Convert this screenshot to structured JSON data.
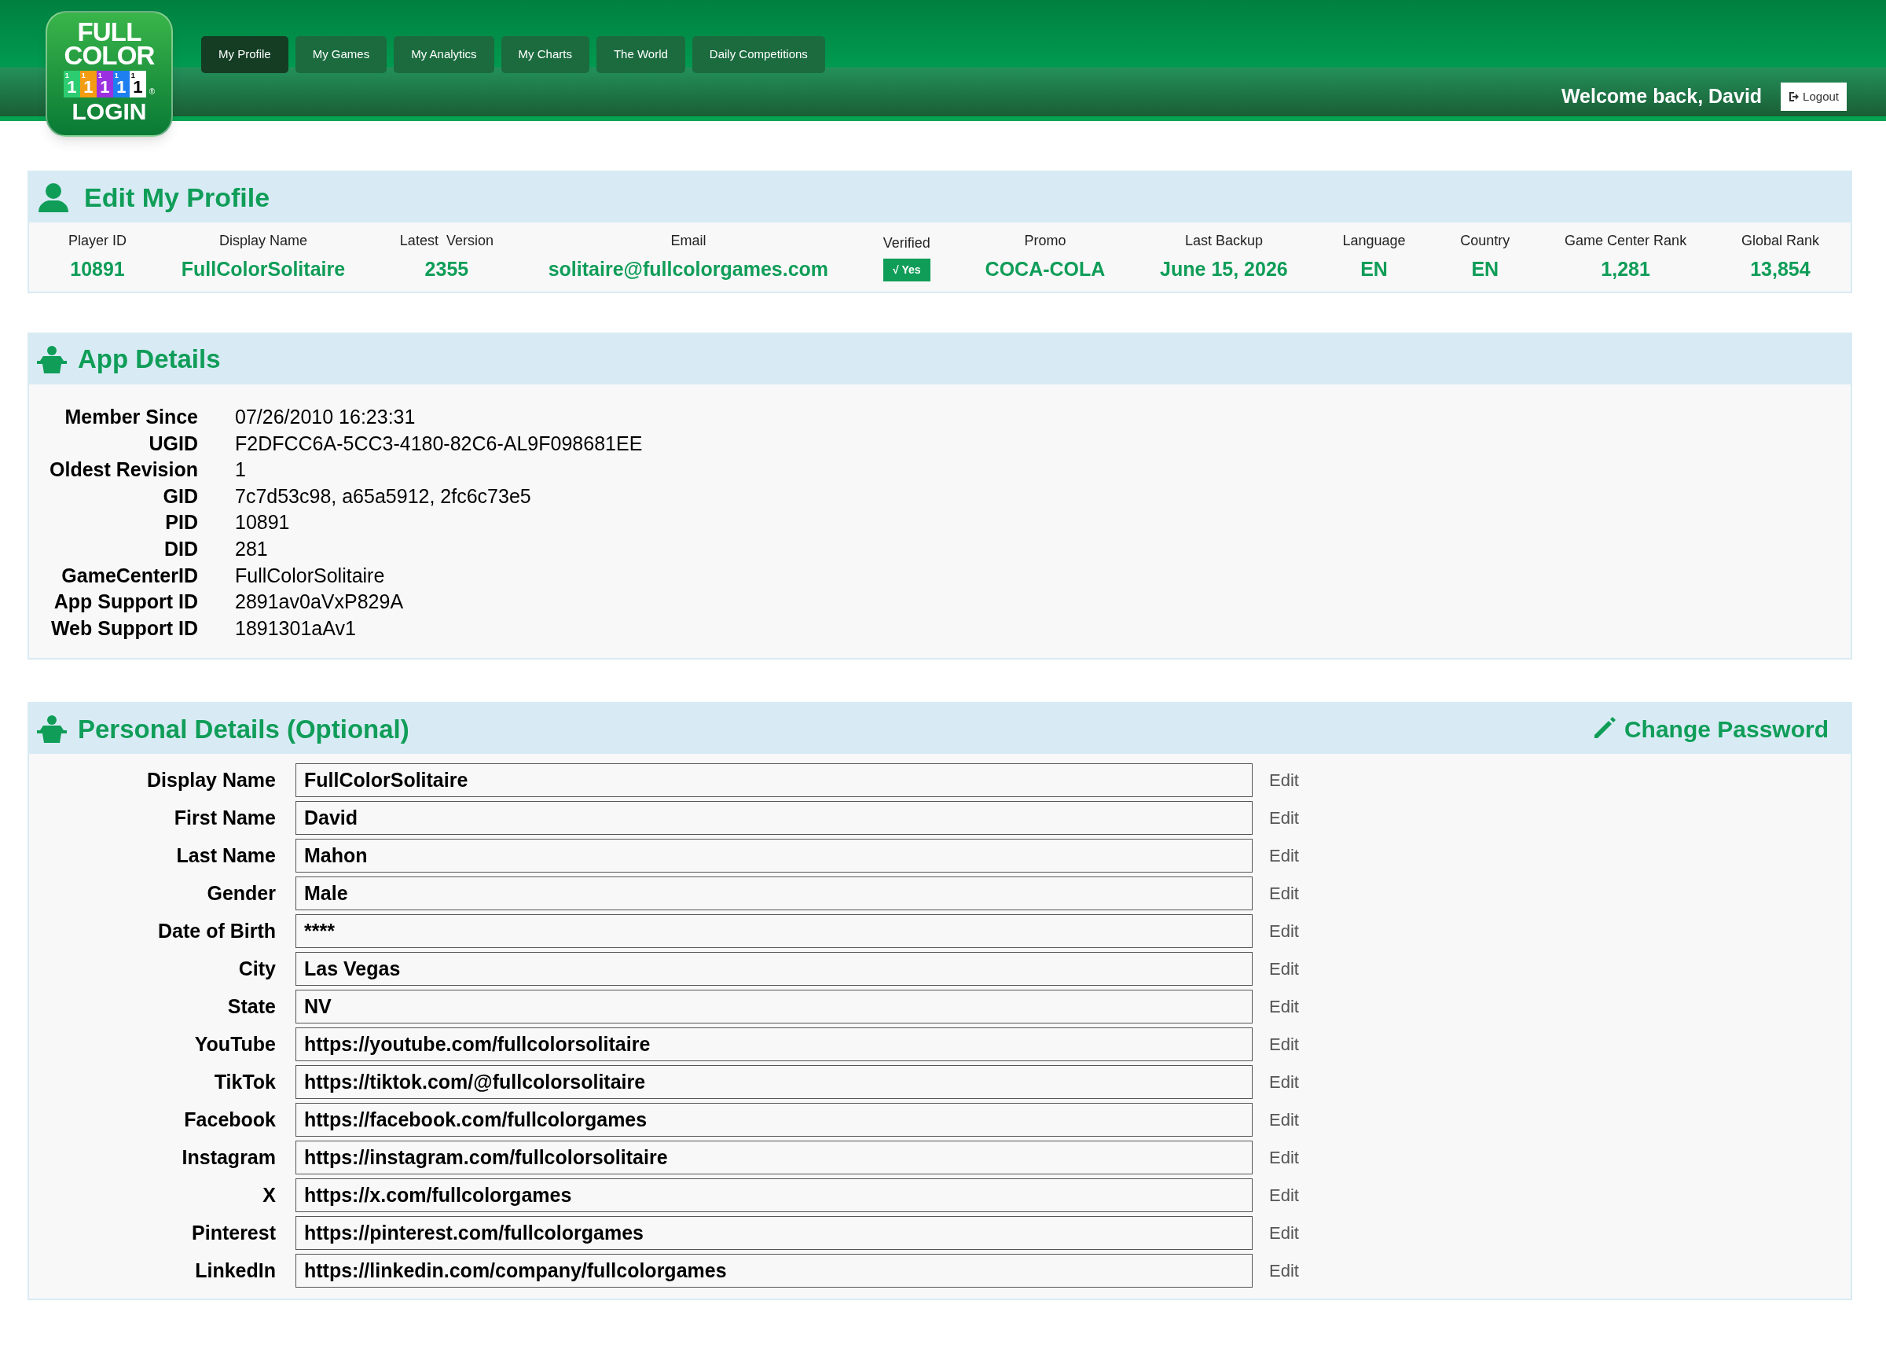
{
  "logo": {
    "lines": [
      "FULL",
      "COLOR"
    ],
    "bottom": "LOGIN",
    "registered": "®",
    "tiles": [
      {
        "color": "#2ecc71",
        "corner": "1",
        "digit": "1"
      },
      {
        "color": "#f39c12",
        "corner": "1",
        "digit": "1"
      },
      {
        "color": "#9b30e0",
        "corner": "1",
        "digit": "1"
      },
      {
        "color": "#1e7ff0",
        "corner": "1",
        "digit": "1"
      },
      {
        "color": "#ffffff",
        "corner": "1",
        "digit": "1"
      }
    ]
  },
  "nav": [
    {
      "label": "My Profile",
      "selected": true
    },
    {
      "label": "My Games",
      "selected": false
    },
    {
      "label": "My Analytics",
      "selected": false
    },
    {
      "label": "My Charts",
      "selected": false
    },
    {
      "label": "The World",
      "selected": false
    },
    {
      "label": "Daily Competitions",
      "selected": false
    }
  ],
  "welcome": "Welcome back, David",
  "logout": "Logout",
  "profile": {
    "title": "Edit My Profile",
    "fields": [
      {
        "label": "Player ID",
        "value": "10891",
        "kind": "text"
      },
      {
        "label": "Display Name",
        "value": "FullColorSolitaire",
        "kind": "text"
      },
      {
        "label": "Latest  Version",
        "value": "2355",
        "kind": "text"
      },
      {
        "label": "Email",
        "value": "solitaire@fullcolorgames.com",
        "kind": "text"
      },
      {
        "label": "Verified",
        "value": "√ Yes",
        "kind": "badge"
      },
      {
        "label": "Promo",
        "value": "COCA-COLA",
        "kind": "text"
      },
      {
        "label": "Last Backup",
        "value": "June 15, 2026",
        "kind": "text"
      },
      {
        "label": "Language",
        "value": "EN",
        "kind": "text"
      },
      {
        "label": "Country",
        "value": "EN",
        "kind": "text"
      },
      {
        "label": "Game Center Rank",
        "value": "1,281",
        "kind": "text"
      },
      {
        "label": "Global Rank",
        "value": "13,854",
        "kind": "text"
      }
    ]
  },
  "app_details": {
    "title": "App Details",
    "rows": [
      {
        "label": "Member Since",
        "value": "07/26/2010 16:23:31"
      },
      {
        "label": "UGID",
        "value": "F2DFCC6A-5CC3-4180-82C6-AL9F098681EE"
      },
      {
        "label": "Oldest Revision",
        "value": "1"
      },
      {
        "label": "GID",
        "value": "7c7d53c98, a65a5912, 2fc6c73e5"
      },
      {
        "label": "PID",
        "value": "10891"
      },
      {
        "label": "DID",
        "value": "281"
      },
      {
        "label": "GameCenterID",
        "value": "FullColorSolitaire"
      },
      {
        "label": "App Support ID",
        "value": "2891av0aVxP829A"
      },
      {
        "label": "Web Support ID",
        "value": "1891301aAv1"
      }
    ]
  },
  "personal": {
    "title": "Personal Details (Optional)",
    "change_password": "Change Password",
    "rows": [
      {
        "label": "Display Name",
        "value": "FullColorSolitaire",
        "action": "Edit"
      },
      {
        "label": "First Name",
        "value": "David",
        "action": "Edit"
      },
      {
        "label": "Last Name",
        "value": "Mahon",
        "action": "Edit"
      },
      {
        "label": "Gender",
        "value": "Male",
        "action": "Edit"
      },
      {
        "label": "Date of Birth",
        "value": "****",
        "action": "Edit"
      },
      {
        "label": "City",
        "value": "Las Vegas",
        "action": "Edit"
      },
      {
        "label": "State",
        "value": "NV",
        "action": "Edit"
      },
      {
        "label": "YouTube",
        "value": "https://youtube.com/fullcolorsolitaire",
        "action": "Edit"
      },
      {
        "label": "TikTok",
        "value": "https://tiktok.com/@fullcolorsolitaire",
        "action": "Edit"
      },
      {
        "label": "Facebook",
        "value": "https://facebook.com/fullcolorgames",
        "action": "Edit"
      },
      {
        "label": "Instagram",
        "value": "https://instagram.com/fullcolorsolitaire",
        "action": "Edit"
      },
      {
        "label": "X",
        "value": "https://x.com/fullcolorgames",
        "action": "Edit"
      },
      {
        "label": "Pinterest",
        "value": "https://pinterest.com/fullcolorgames",
        "action": "Edit"
      },
      {
        "label": "LinkedIn",
        "value": "https://linkedin.com/company/fullcolorgames",
        "action": "Edit"
      }
    ]
  }
}
